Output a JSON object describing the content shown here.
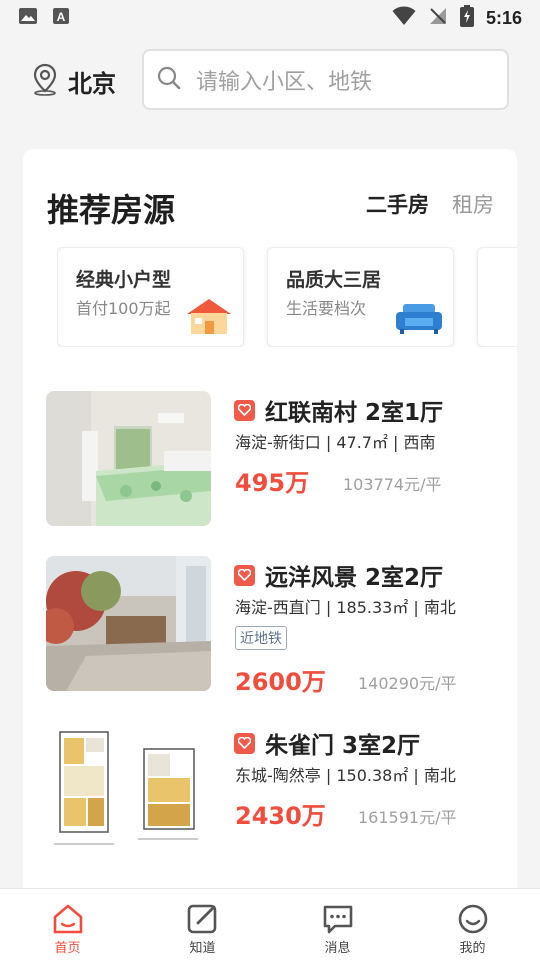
{
  "status_bar": {
    "time": "5:16"
  },
  "header": {
    "city": "北京",
    "search_placeholder": "请输入小区、地铁"
  },
  "section": {
    "title": "推荐房源",
    "tabs": [
      {
        "label": "二手房",
        "active": true
      },
      {
        "label": "租房",
        "active": false
      }
    ]
  },
  "promos": [
    {
      "title": "经典小户型",
      "subtitle": "首付100万起",
      "icon": "house-icon"
    },
    {
      "title": "品质大三居",
      "subtitle": "生活要档次",
      "icon": "sofa-icon"
    }
  ],
  "listings": [
    {
      "title": "红联南村 2室1厅",
      "meta": "海淀-新街口 | 47.7㎡ | 西南",
      "tag": "",
      "price": "495万",
      "unit_price": "103774元/平",
      "image": "bedroom-photo"
    },
    {
      "title": "远洋风景 2室2厅",
      "meta": "海淀-西直门 | 185.33㎡ | 南北",
      "tag": "近地铁",
      "price": "2600万",
      "unit_price": "140290元/平",
      "image": "patio-photo"
    },
    {
      "title": "朱雀门 3室2厅",
      "meta": "东城-陶然亭 | 150.38㎡ | 南北",
      "tag": "",
      "price": "2430万",
      "unit_price": "161591元/平",
      "image": "floorplan-image"
    }
  ],
  "bottom_nav": [
    {
      "label": "首页",
      "icon": "home-icon",
      "active": true
    },
    {
      "label": "知道",
      "icon": "edit-icon",
      "active": false
    },
    {
      "label": "消息",
      "icon": "chat-icon",
      "active": false
    },
    {
      "label": "我的",
      "icon": "smile-icon",
      "active": false
    }
  ],
  "colors": {
    "accent": "#f14d3d",
    "muted": "#a0a0a0",
    "background": "#f4f4f4"
  }
}
